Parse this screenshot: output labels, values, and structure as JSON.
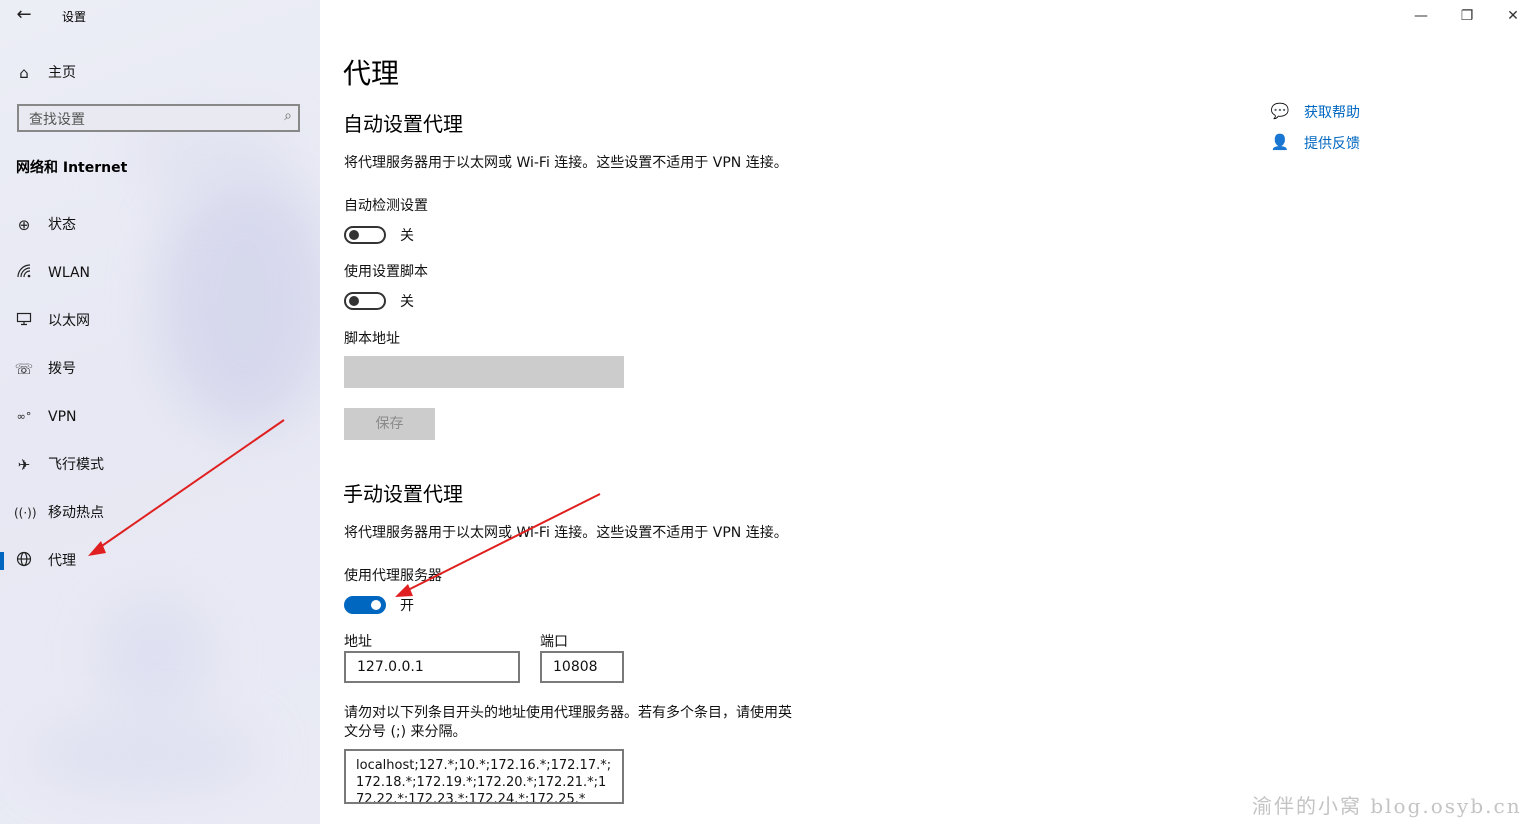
{
  "window": {
    "title": "设置",
    "back_icon": "arrow-left-icon",
    "minimize": "—",
    "restore": "❐",
    "close": "✕"
  },
  "sidebar": {
    "home": {
      "label": "主页",
      "icon": "home-icon"
    },
    "search": {
      "placeholder": "查找设置",
      "icon": "search-icon"
    },
    "section": "网络和 Internet",
    "items": [
      {
        "label": "状态",
        "icon": "globe-status-icon"
      },
      {
        "label": "WLAN",
        "icon": "wifi-icon"
      },
      {
        "label": "以太网",
        "icon": "ethernet-icon"
      },
      {
        "label": "拨号",
        "icon": "dialup-icon"
      },
      {
        "label": "VPN",
        "icon": "vpn-icon"
      },
      {
        "label": "飞行模式",
        "icon": "airplane-icon"
      },
      {
        "label": "移动热点",
        "icon": "hotspot-icon"
      },
      {
        "label": "代理",
        "icon": "globe-icon",
        "active": true
      }
    ]
  },
  "main": {
    "title": "代理",
    "auto": {
      "heading": "自动设置代理",
      "description": "将代理服务器用于以太网或 Wi-Fi 连接。这些设置不适用于 VPN 连接。",
      "detect_label": "自动检测设置",
      "detect_state": "关",
      "script_label": "使用设置脚本",
      "script_state": "关",
      "script_address_label": "脚本地址",
      "save_button": "保存"
    },
    "manual": {
      "heading": "手动设置代理",
      "description": "将代理服务器用于以太网或 Wi-Fi 连接。这些设置不适用于 VPN 连接。",
      "use_proxy_label": "使用代理服务器",
      "use_proxy_state": "开",
      "address_label": "地址",
      "address_value": "127.0.0.1",
      "port_label": "端口",
      "port_value": "10808",
      "exceptions_line1": "请勿对以下列条目开头的地址使用代理服务器。若有多个条目，请使用英",
      "exceptions_line2": "文分号 (;) 来分隔。",
      "exceptions_value": "localhost;127.*;10.*;172.16.*;172.17.*;172.18.*;172.19.*;172.20.*;172.21.*;172.22.*;172.23.*;172.24.*;172.25.*"
    }
  },
  "help": {
    "get_help": "获取帮助",
    "feedback": "提供反馈"
  },
  "watermark": "渝伴的小窝 blog.osyb.cn",
  "colors": {
    "accent": "#0067c0",
    "annotation_arrow": "#e02020"
  }
}
